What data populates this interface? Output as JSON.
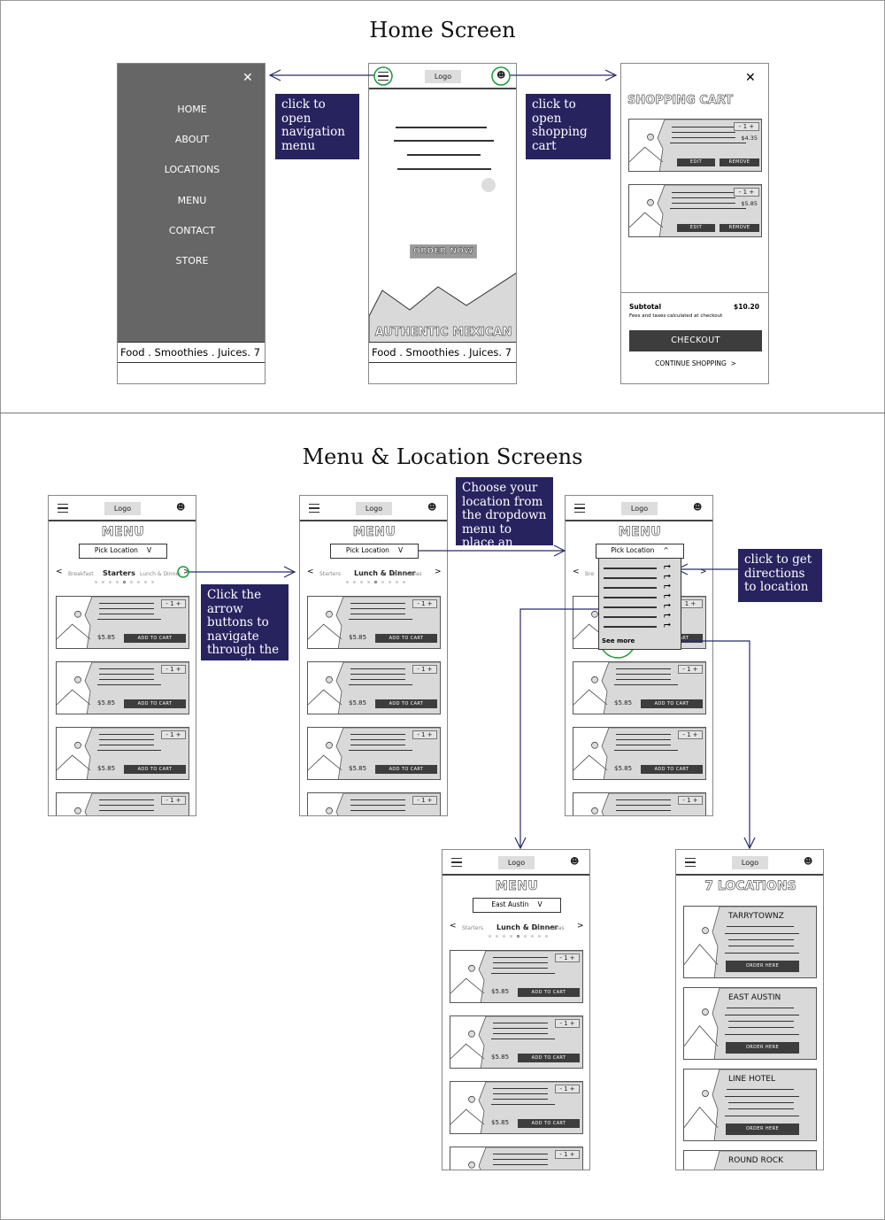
{
  "sections": {
    "home_title": "Home Screen",
    "menu_title": "Menu & Location Screens"
  },
  "colors": {
    "note_bg": "#27235f",
    "arrow": "#2b2a6b",
    "highlight": "#1a9a3a",
    "panel_gray": "#666666",
    "card_gray": "#d9d9d9",
    "button_dark": "#3d3d3d"
  },
  "notes": {
    "nav": "click to open navigation menu",
    "cart": "click to open shopping cart",
    "arrows": "Click the arrow buttons to navigate through the menu items",
    "location": "Choose your location from the dropdown menu to place an order",
    "directions": "click to get directions to location"
  },
  "nav_menu": {
    "close_icon": "close-icon",
    "items": [
      "HOME",
      "ABOUT",
      "LOCATIONS",
      "MENU",
      "CONTACT",
      "STORE"
    ],
    "footer": "Food . Smoothies . Juices. 7"
  },
  "home": {
    "logo": "Logo",
    "order_button": "ORDER NOW",
    "banner": "AUTHENTIC MEXICAN",
    "footer": "Food . Smoothies . Juices. 7"
  },
  "cart": {
    "title": "SHOPPING CART",
    "items": [
      {
        "qty": "- 1 +",
        "price": "$4.35",
        "edit": "EDIT",
        "remove": "REMOVE"
      },
      {
        "qty": "- 1 +",
        "price": "$5.85",
        "edit": "EDIT",
        "remove": "REMOVE"
      }
    ],
    "subtotal_label": "Subtotal",
    "subtotal_value": "$10.20",
    "fees_note": "Fees and taxes calculated at checkout",
    "checkout": "CHECKOUT",
    "continue": "CONTINUE SHOPPING  >"
  },
  "menu_screens": [
    {
      "logo": "Logo",
      "title": "MENU",
      "location": "Pick Location",
      "caret": "V",
      "tabs": [
        "Breakfast",
        "Starters",
        "Lunch & Dinner"
      ],
      "prev": "<",
      "next": ">",
      "items": [
        {
          "qty": "- 1 +",
          "price": "$5.85",
          "button": "ADD TO CART"
        },
        {
          "qty": "- 1 +",
          "price": "$5.85",
          "button": "ADD TO CART"
        },
        {
          "qty": "- 1 +",
          "price": "$5.85",
          "button": "ADD TO CART"
        },
        {
          "qty": "- 1 +"
        }
      ]
    },
    {
      "logo": "Logo",
      "title": "MENU",
      "location": "Pick Location",
      "caret": "V",
      "tabs": [
        "Starters",
        "Lunch & Dinner",
        "Quesadillas"
      ],
      "prev": "<",
      "next": ">",
      "items": [
        {
          "qty": "- 1 +",
          "price": "$5.85",
          "button": "ADD TO CART"
        },
        {
          "qty": "- 1 +",
          "price": "$5.85",
          "button": "ADD TO CART"
        },
        {
          "qty": "- 1 +",
          "price": "$5.85",
          "button": "ADD TO CART"
        },
        {
          "qty": "- 1 +"
        }
      ]
    },
    {
      "logo": "Logo",
      "title": "MENU",
      "location": "Pick Location",
      "caret": "^",
      "tabs": [
        "Bre",
        "",
        "h"
      ],
      "prev": "<",
      "next": ">",
      "dropdown": {
        "rows": 7,
        "see_more": "See more"
      },
      "items": [
        {
          "qty": "1 +",
          "price": "$5.85",
          "button": "ADD TO CART"
        },
        {
          "qty": "- 1 +",
          "price": "$5.85",
          "button": "ADD TO CART"
        },
        {
          "qty": "- 1 +",
          "price": "$5.85",
          "button": "ADD TO CART"
        },
        {
          "qty": "- 1 +"
        }
      ]
    },
    {
      "logo": "Logo",
      "title": "MENU",
      "location": "East Austin",
      "caret": "V",
      "tabs": [
        "Starters",
        "Lunch & Dinner",
        "Quesadillas"
      ],
      "prev": "<",
      "next": ">",
      "items": [
        {
          "qty": "- 1 +",
          "price": "$5.85",
          "button": "ADD TO CART"
        },
        {
          "qty": "- 1 +",
          "price": "$5.85",
          "button": "ADD TO CART"
        },
        {
          "qty": "- 1 +",
          "price": "$5.85",
          "button": "ADD TO CART"
        },
        {
          "qty": "- 1 +"
        }
      ]
    }
  ],
  "locations": {
    "logo": "Logo",
    "title": "7 LOCATIONS",
    "items": [
      {
        "name": "TARRYTOWNZ",
        "button": "ORDER HERE"
      },
      {
        "name": "EAST AUSTIN",
        "button": "ORDER HERE"
      },
      {
        "name": "LINE HOTEL",
        "button": "ORDER HERE"
      },
      {
        "name": "ROUND ROCK"
      }
    ]
  }
}
